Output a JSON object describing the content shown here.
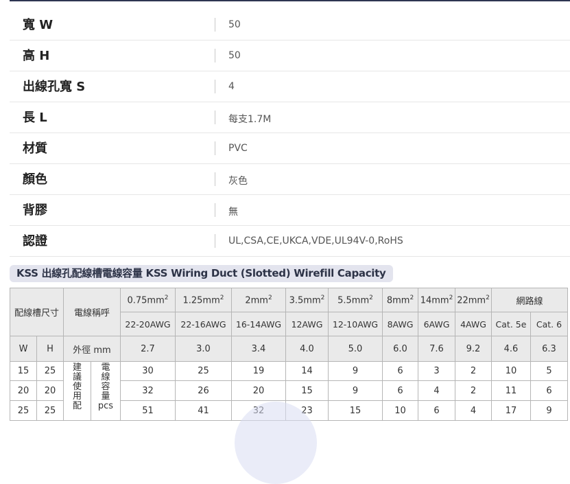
{
  "specs": [
    {
      "label": "寬 W",
      "value": "50"
    },
    {
      "label": "高 H",
      "value": "50"
    },
    {
      "label": "出線孔寬 S",
      "value": "4"
    },
    {
      "label": "長 L",
      "value": "每支1.7M"
    },
    {
      "label": "材質",
      "value": "PVC"
    },
    {
      "label": "顏色",
      "value": "灰色"
    },
    {
      "label": "背膠",
      "value": "無"
    },
    {
      "label": "認證",
      "value": "UL,CSA,CE,UKCA,VDE,UL94V-0,RoHS"
    }
  ],
  "capacity": {
    "heading": "KSS 出線孔配線槽電線容量  KSS Wiring Duct (Slotted) Wirefill Capacity",
    "size_label": "配線槽尺寸",
    "wire_label": "電線稱呼",
    "sizes": [
      "0.75mm",
      "1.25mm",
      "2mm",
      "3.5mm",
      "5.5mm",
      "8mm",
      "14mm",
      "22mm"
    ],
    "sup": "2",
    "network_label": "網路線",
    "awg": [
      "22-20AWG",
      "22-16AWG",
      "16-14AWG",
      "12AWG",
      "12-10AWG",
      "8AWG",
      "6AWG",
      "4AWG",
      "Cat. 5e",
      "Cat. 6"
    ],
    "w_label": "W",
    "h_label": "H",
    "od_label": "外徑 mm",
    "od": [
      "2.7",
      "3.0",
      "3.4",
      "4.0",
      "5.0",
      "6.0",
      "7.6",
      "9.2",
      "4.6",
      "6.3"
    ],
    "suggest_chars": [
      "建",
      "議",
      "使",
      "用",
      "配"
    ],
    "capacity_chars": [
      "電",
      "線",
      "容",
      "量",
      "pcs"
    ],
    "rows": [
      {
        "w": "15",
        "h": "25",
        "vals": [
          "30",
          "25",
          "19",
          "14",
          "9",
          "6",
          "3",
          "2",
          "10",
          "5"
        ]
      },
      {
        "w": "20",
        "h": "20",
        "vals": [
          "32",
          "26",
          "20",
          "15",
          "9",
          "6",
          "4",
          "2",
          "11",
          "6"
        ]
      },
      {
        "w": "25",
        "h": "25",
        "vals": [
          "51",
          "41",
          "32",
          "23",
          "15",
          "10",
          "6",
          "4",
          "17",
          "9"
        ]
      }
    ]
  }
}
